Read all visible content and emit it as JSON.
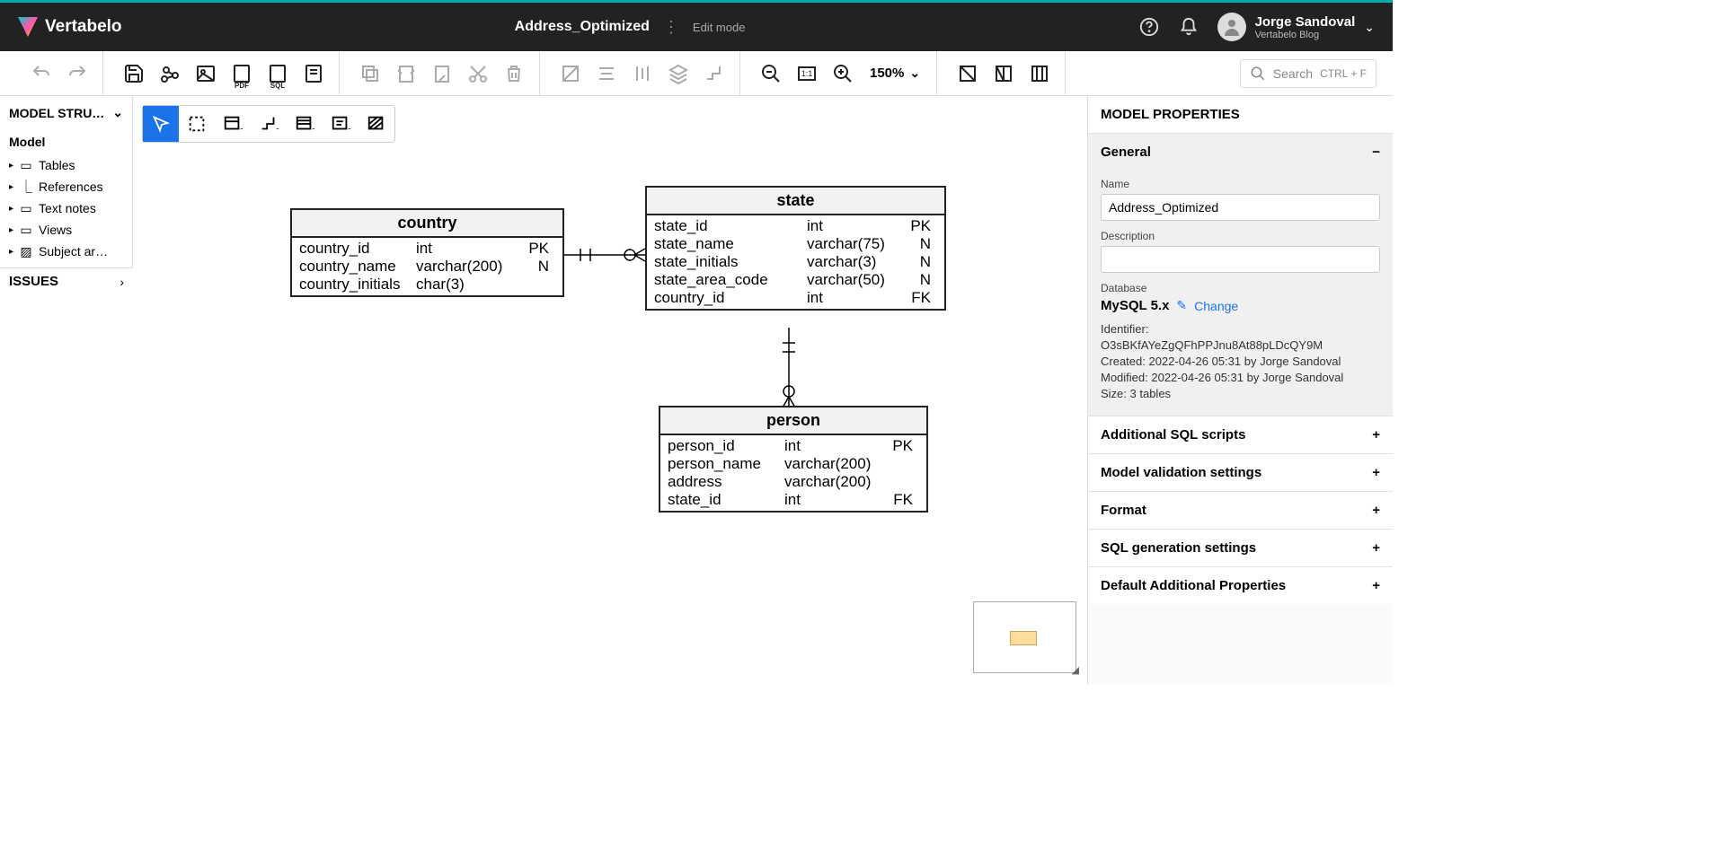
{
  "app": {
    "brand": "Vertabelo"
  },
  "header": {
    "title": "Address_Optimized",
    "mode": "Edit mode",
    "user_name": "Jorge Sandoval",
    "user_sub": "Vertabelo Blog"
  },
  "toolbar": {
    "zoom": "150%",
    "search_placeholder": "Search",
    "search_shortcut": "CTRL + F"
  },
  "left": {
    "panel_title": "MODEL STRU…",
    "root": "Model",
    "items": [
      "Tables",
      "References",
      "Text notes",
      "Views",
      "Subject ar…"
    ]
  },
  "issues": {
    "label": "ISSUES"
  },
  "entities": {
    "country": {
      "title": "country",
      "rows": [
        {
          "name": "country_id",
          "type": "int",
          "flag": "PK"
        },
        {
          "name": "country_name",
          "type": "varchar(200)",
          "flag": "N"
        },
        {
          "name": "country_initials",
          "type": "char(3)",
          "flag": ""
        }
      ]
    },
    "state": {
      "title": "state",
      "rows": [
        {
          "name": "state_id",
          "type": "int",
          "flag": "PK"
        },
        {
          "name": "state_name",
          "type": "varchar(75)",
          "flag": "N"
        },
        {
          "name": "state_initials",
          "type": "varchar(3)",
          "flag": "N"
        },
        {
          "name": "state_area_code",
          "type": "varchar(50)",
          "flag": "N"
        },
        {
          "name": "country_id",
          "type": "int",
          "flag": "FK"
        }
      ]
    },
    "person": {
      "title": "person",
      "rows": [
        {
          "name": "person_id",
          "type": "int",
          "flag": "PK"
        },
        {
          "name": "person_name",
          "type": "varchar(200)",
          "flag": ""
        },
        {
          "name": "address",
          "type": "varchar(200)",
          "flag": ""
        },
        {
          "name": "state_id",
          "type": "int",
          "flag": "FK"
        }
      ]
    }
  },
  "right": {
    "title": "MODEL PROPERTIES",
    "general": "General",
    "name_label": "Name",
    "name_value": "Address_Optimized",
    "desc_label": "Description",
    "desc_value": "",
    "db_label": "Database",
    "db_name": "MySQL 5.x",
    "change": "Change",
    "ident_label": "Identifier:",
    "ident_value": "O3sBKfAYeZgQFhPPJnu8At88pLDcQY9M",
    "created": "Created: 2022-04-26 05:31 by Jorge Sandoval",
    "modified": "Modified: 2022-04-26 05:31 by Jorge Sandoval",
    "size": "Size: 3 tables",
    "sections": [
      "Additional SQL scripts",
      "Model validation settings",
      "Format",
      "SQL generation settings",
      "Default Additional Properties"
    ]
  }
}
